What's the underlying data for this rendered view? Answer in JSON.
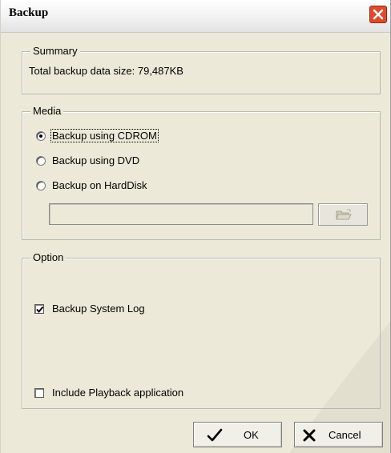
{
  "window": {
    "title": "Backup"
  },
  "summary": {
    "legend": "Summary",
    "text": "Total backup data size: 79,487KB"
  },
  "media": {
    "legend": "Media",
    "options": [
      {
        "label": "Backup using CDROM",
        "selected": true
      },
      {
        "label": "Backup using DVD",
        "selected": false
      },
      {
        "label": "Backup on HardDisk",
        "selected": false
      }
    ],
    "path_value": ""
  },
  "option": {
    "legend": "Option",
    "system_log": {
      "label": "Backup System Log",
      "checked": true
    },
    "playback": {
      "label": "Include Playback application",
      "checked": false
    }
  },
  "buttons": {
    "ok": "OK",
    "cancel": "Cancel"
  },
  "icons": {
    "close": "close-icon",
    "folder": "folder-open-icon",
    "ok": "checkmark-icon",
    "cancel": "x-icon"
  },
  "colors": {
    "dialog_bg": "#ece9d8",
    "close_button": "#e04a2b"
  }
}
